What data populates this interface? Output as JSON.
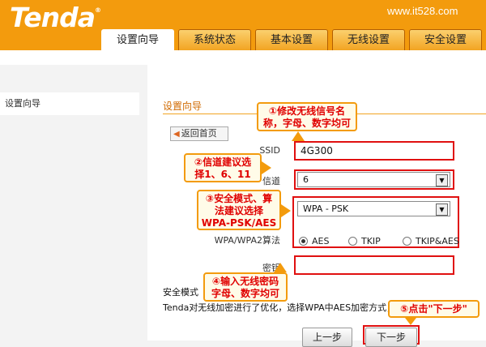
{
  "header": {
    "logo": "Tenda",
    "logo_mark": "®",
    "watermark": "www.it528.com"
  },
  "tabs": [
    {
      "label": "设置向导",
      "active": true
    },
    {
      "label": "系统状态"
    },
    {
      "label": "基本设置"
    },
    {
      "label": "无线设置"
    },
    {
      "label": "安全设置"
    }
  ],
  "sidebar": {
    "items": [
      {
        "label": "设置向导"
      }
    ]
  },
  "main": {
    "title": "设置向导",
    "home_button": "返回首页",
    "ssid_label": "SSID",
    "ssid_value": "4G300",
    "channel_label": "信道",
    "channel_value": "6",
    "security_mode_value": "WPA - PSK",
    "wpa2_label": "WPA/WPA2算法",
    "algos": [
      "AES",
      "TKIP",
      "TKIP&AES"
    ],
    "key_label": "密钥",
    "key_value": "",
    "security_mode_label": "安全模式",
    "note": "Tenda对无线加密进行了优化，选择WPA中AES加密方式，",
    "prev_button": "上一步",
    "next_button": "下一步"
  },
  "callouts": {
    "c1": [
      "①修改无线信号名",
      "称，字母、数字均可"
    ],
    "c2": [
      "②信道建议选",
      "择1、6、11"
    ],
    "c3": [
      "③安全模式、算",
      "法建议选择",
      "WPA-PSK/AES"
    ],
    "c4": [
      "④输入无线密码",
      "字母、数字均可"
    ],
    "c5": "⑤点击\"下一步\""
  },
  "colors": {
    "brand": "#f39b0d",
    "highlight": "#e01010",
    "title": "#d06a00"
  }
}
